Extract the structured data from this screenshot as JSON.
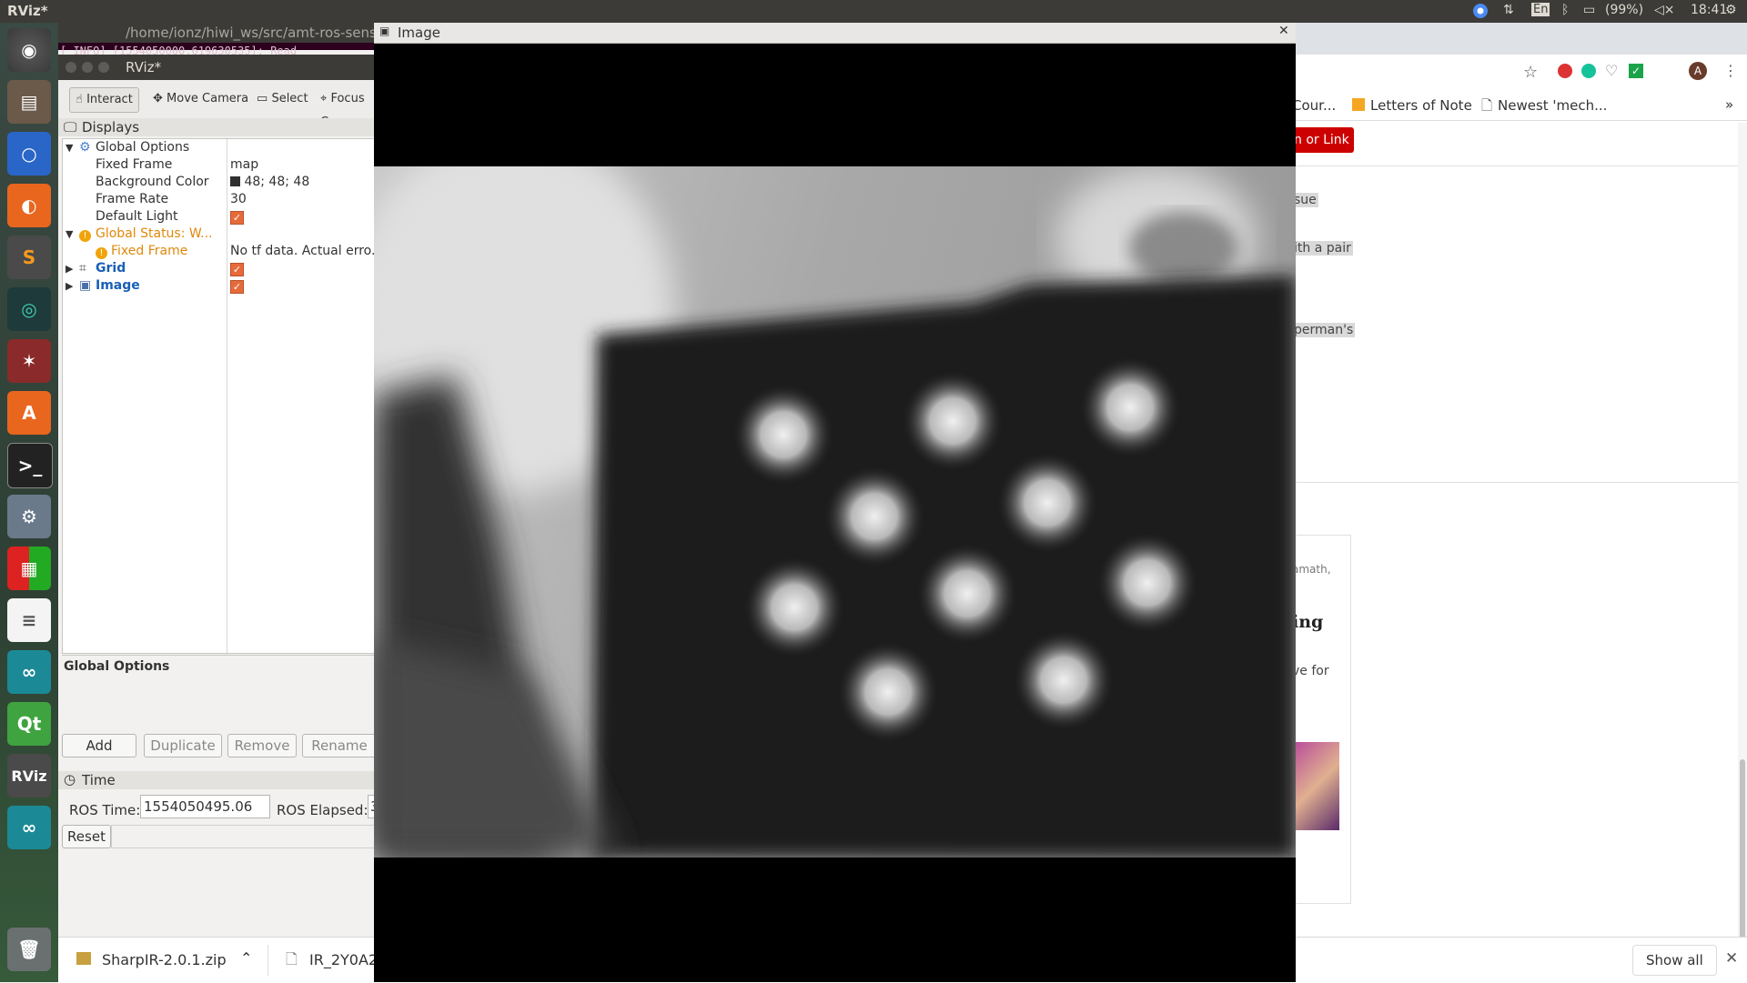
{
  "top_panel": {
    "app_title": "RViz*",
    "keyboard": "En",
    "battery": "(99%)",
    "clock": "18:41"
  },
  "terminal": {
    "title": "/home/ionz/hiwi_ws/src/amt-ros-sens",
    "output": "[ INFO] [1554050000.619630535]: Read"
  },
  "rviz": {
    "window_title": "RViz*",
    "toolbar": {
      "interact": "Interact",
      "move_camera": "Move Camera",
      "select": "Select",
      "focus": "Focus C"
    },
    "displays_title": "Displays",
    "tree": {
      "global_options": "Global Options",
      "fixed_frame_label": "Fixed Frame",
      "fixed_frame_value": "map",
      "bg_color_label": "Background Color",
      "bg_color_value": "48; 48; 48",
      "frame_rate_label": "Frame Rate",
      "frame_rate_value": "30",
      "default_light_label": "Default Light",
      "global_status": "Global Status: W...",
      "status_fixed_frame": "Fixed Frame",
      "status_message": "No tf data.  Actual erro...",
      "grid": "Grid",
      "image": "Image"
    },
    "property_title": "Global Options",
    "buttons": {
      "add": "Add",
      "duplicate": "Duplicate",
      "remove": "Remove",
      "rename": "Rename"
    },
    "time_title": "Time",
    "ros_time_label": "ROS Time:",
    "ros_time_value": "1554050495.06",
    "ros_elapsed_label": "ROS Elapsed:",
    "ros_elapsed_value": "3",
    "reset": "Reset"
  },
  "image_window": {
    "title": "Image"
  },
  "browser": {
    "bookmarks": [
      "Cour...",
      "Letters of Note",
      "Newest 'mech..."
    ],
    "signin_button": "n or Link",
    "snippets": [
      "sue",
      "ith a pair",
      "perman's"
    ],
    "card": {
      "author": "amath,",
      "heading": "ing",
      "text": "ve for"
    },
    "avatar_letter": "A"
  },
  "downloads": {
    "file1": "SharpIR-2.0.1.zip",
    "file2": "IR_2Y0A2",
    "show_all": "Show all"
  },
  "colors": {
    "accent_orange": "#e76b3a",
    "warning": "#f0a40a",
    "link_blue": "#1a5fb4"
  }
}
